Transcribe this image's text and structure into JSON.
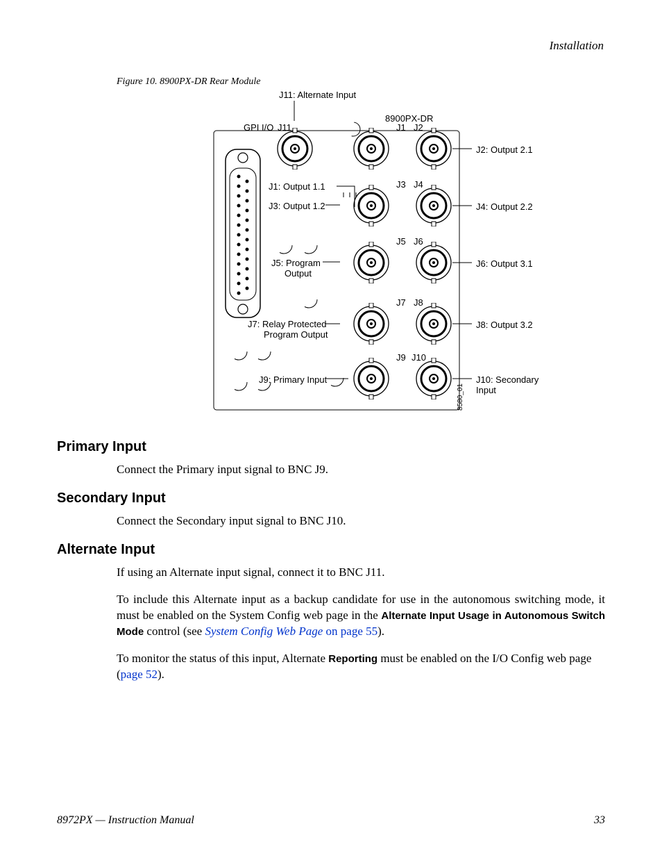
{
  "header": {
    "section": "Installation"
  },
  "figure": {
    "caption": "Figure 10.  8900PX-DR Rear Module",
    "topLabel": "J11: Alternate Input",
    "panelTitle": "8900PX-DR",
    "gpiLabel": "GPI I/O",
    "sideCode": "8580_01",
    "connectors": {
      "j11": "J11",
      "j1": "J1",
      "j2": "J2",
      "j3": "J3",
      "j4": "J4",
      "j5": "J5",
      "j6": "J6",
      "j7": "J7",
      "j8": "J8",
      "j9": "J9",
      "j10": "J10"
    },
    "leftLabels": {
      "j1": "J1: Output 1.1",
      "j3": "J3: Output 1.2",
      "j5a": "J5: Program",
      "j5b": "Output",
      "j7a": "J7: Relay Protected",
      "j7b": "Program Output",
      "j9": "J9: Primary Input"
    },
    "rightLabels": {
      "j2": "J2: Output 2.1",
      "j4": "J4: Output 2.2",
      "j6": "J6: Output 3.1",
      "j8": "J8: Output 3.2",
      "j10": "J10: Secondary Input"
    }
  },
  "sections": {
    "primary": {
      "title": "Primary Input",
      "p1": "Connect the Primary input signal to BNC J9."
    },
    "secondary": {
      "title": "Secondary Input",
      "p1": "Connect the Secondary input signal to BNC J10."
    },
    "alternate": {
      "title": "Alternate Input",
      "p1": "If using an Alternate input signal, connect it to BNC J11.",
      "p2a": "To include this Alternate input as a backup candidate for use in the autonomous switching mode, it must be enabled on the System Config web page in the ",
      "p2bold": "Alternate Input Usage in Autonomous Switch Mode",
      "p2b": " control (see ",
      "p2link1": "System Config Web Page",
      "p2link2": " on page 55",
      "p2c": ").",
      "p3a": "To monitor the status of this input, Alternate ",
      "p3bold": "Reporting",
      "p3b": " must be enabled on the I/O Config web page (",
      "p3link": "page 52",
      "p3c": ")."
    }
  },
  "footer": {
    "left": "8972PX — Instruction Manual",
    "right": "33"
  }
}
